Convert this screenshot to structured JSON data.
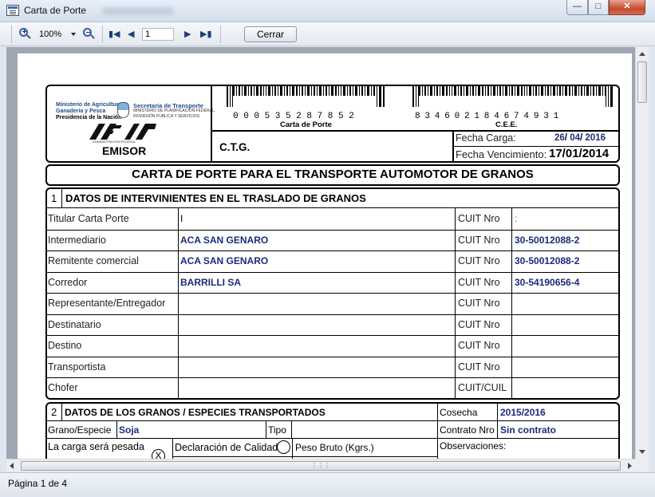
{
  "window": {
    "title": "Carta de Porte"
  },
  "toolbar": {
    "zoom": "100%",
    "page": "1",
    "close_label": "Cerrar"
  },
  "status": {
    "page_info": "Página 1 de 4"
  },
  "doc": {
    "org": {
      "ministry_line1": "Ministerio de Agricultura,",
      "ministry_line2": "Ganadería y Pesca",
      "ministry_line3": "Presidencia de la Nación",
      "transport_title": "Secretaría de Transporte",
      "transport_line1": "MINISTERIO DE PLANIFICACIÓN FEDERAL,",
      "transport_line2": "INVERSIÓN PÚBLICA Y SERVICIOS",
      "afip_caption": "ADMINISTRACIÓN FEDERAL",
      "emisor": "EMISOR"
    },
    "barcode1": {
      "digits": "000535287852",
      "caption": "Carta de Porte"
    },
    "barcode2": {
      "digits": "834602184674931",
      "caption": "C.E.E."
    },
    "ctg": "C.T.G.",
    "fecha_carga_label": "Fecha Carga:",
    "fecha_carga": {
      "day": "26",
      "month": "04",
      "year": "2016",
      "sep": "/"
    },
    "fecha_venc_label": "Fecha Vencimiento:",
    "fecha_venc": "17/01/2014",
    "main_title": "CARTA DE PORTE PARA EL TRANSPORTE AUTOMOTOR DE GRANOS",
    "section1": {
      "num": "1",
      "title": "DATOS DE INTERVINIENTES EN EL TRASLADO DE GRANOS",
      "rows": [
        {
          "label": "Titular Carta Porte",
          "value": "I",
          "cuit_label": "CUIT Nro",
          "cuit": ":"
        },
        {
          "label": "Intermediario",
          "value": "ACA SAN GENARO",
          "cuit_label": "CUIT Nro",
          "cuit": "30-50012088-2"
        },
        {
          "label": "Remitente comercial",
          "value": "ACA SAN GENARO",
          "cuit_label": "CUIT Nro",
          "cuit": "30-50012088-2"
        },
        {
          "label": "Corredor",
          "value": "BARRILLI SA",
          "cuit_label": "CUIT Nro",
          "cuit": "30-54190656-4"
        },
        {
          "label": "Representante/Entregador",
          "value": "",
          "cuit_label": "CUIT Nro",
          "cuit": ""
        },
        {
          "label": "Destinatario",
          "value": "",
          "cuit_label": "CUIT Nro",
          "cuit": ""
        },
        {
          "label": "Destino",
          "value": "",
          "cuit_label": "CUIT Nro",
          "cuit": ""
        },
        {
          "label": "Transportista",
          "value": "",
          "cuit_label": "CUIT Nro",
          "cuit": ""
        },
        {
          "label": "Chofer",
          "value": "",
          "cuit_label": "CUIT/CUIL",
          "cuit": ""
        }
      ]
    },
    "section2": {
      "num": "2",
      "title": "DATOS DE LOS GRANOS / ESPECIES TRANSPORTADOS",
      "cosecha_label": "Cosecha",
      "cosecha": "2015/2016",
      "grano_label": "Grano/Especie",
      "grano": "Soja",
      "tipo_label": "Tipo",
      "contrato_label": "Contrato Nro",
      "contrato": "Sin contrato",
      "carga_label": "La carga será pesada",
      "carga_mark": "X",
      "decl_label": "Declaración de Calidad",
      "peso_label": "Peso Bruto (Kgrs.)",
      "obs_label": "Observaciones:"
    }
  }
}
